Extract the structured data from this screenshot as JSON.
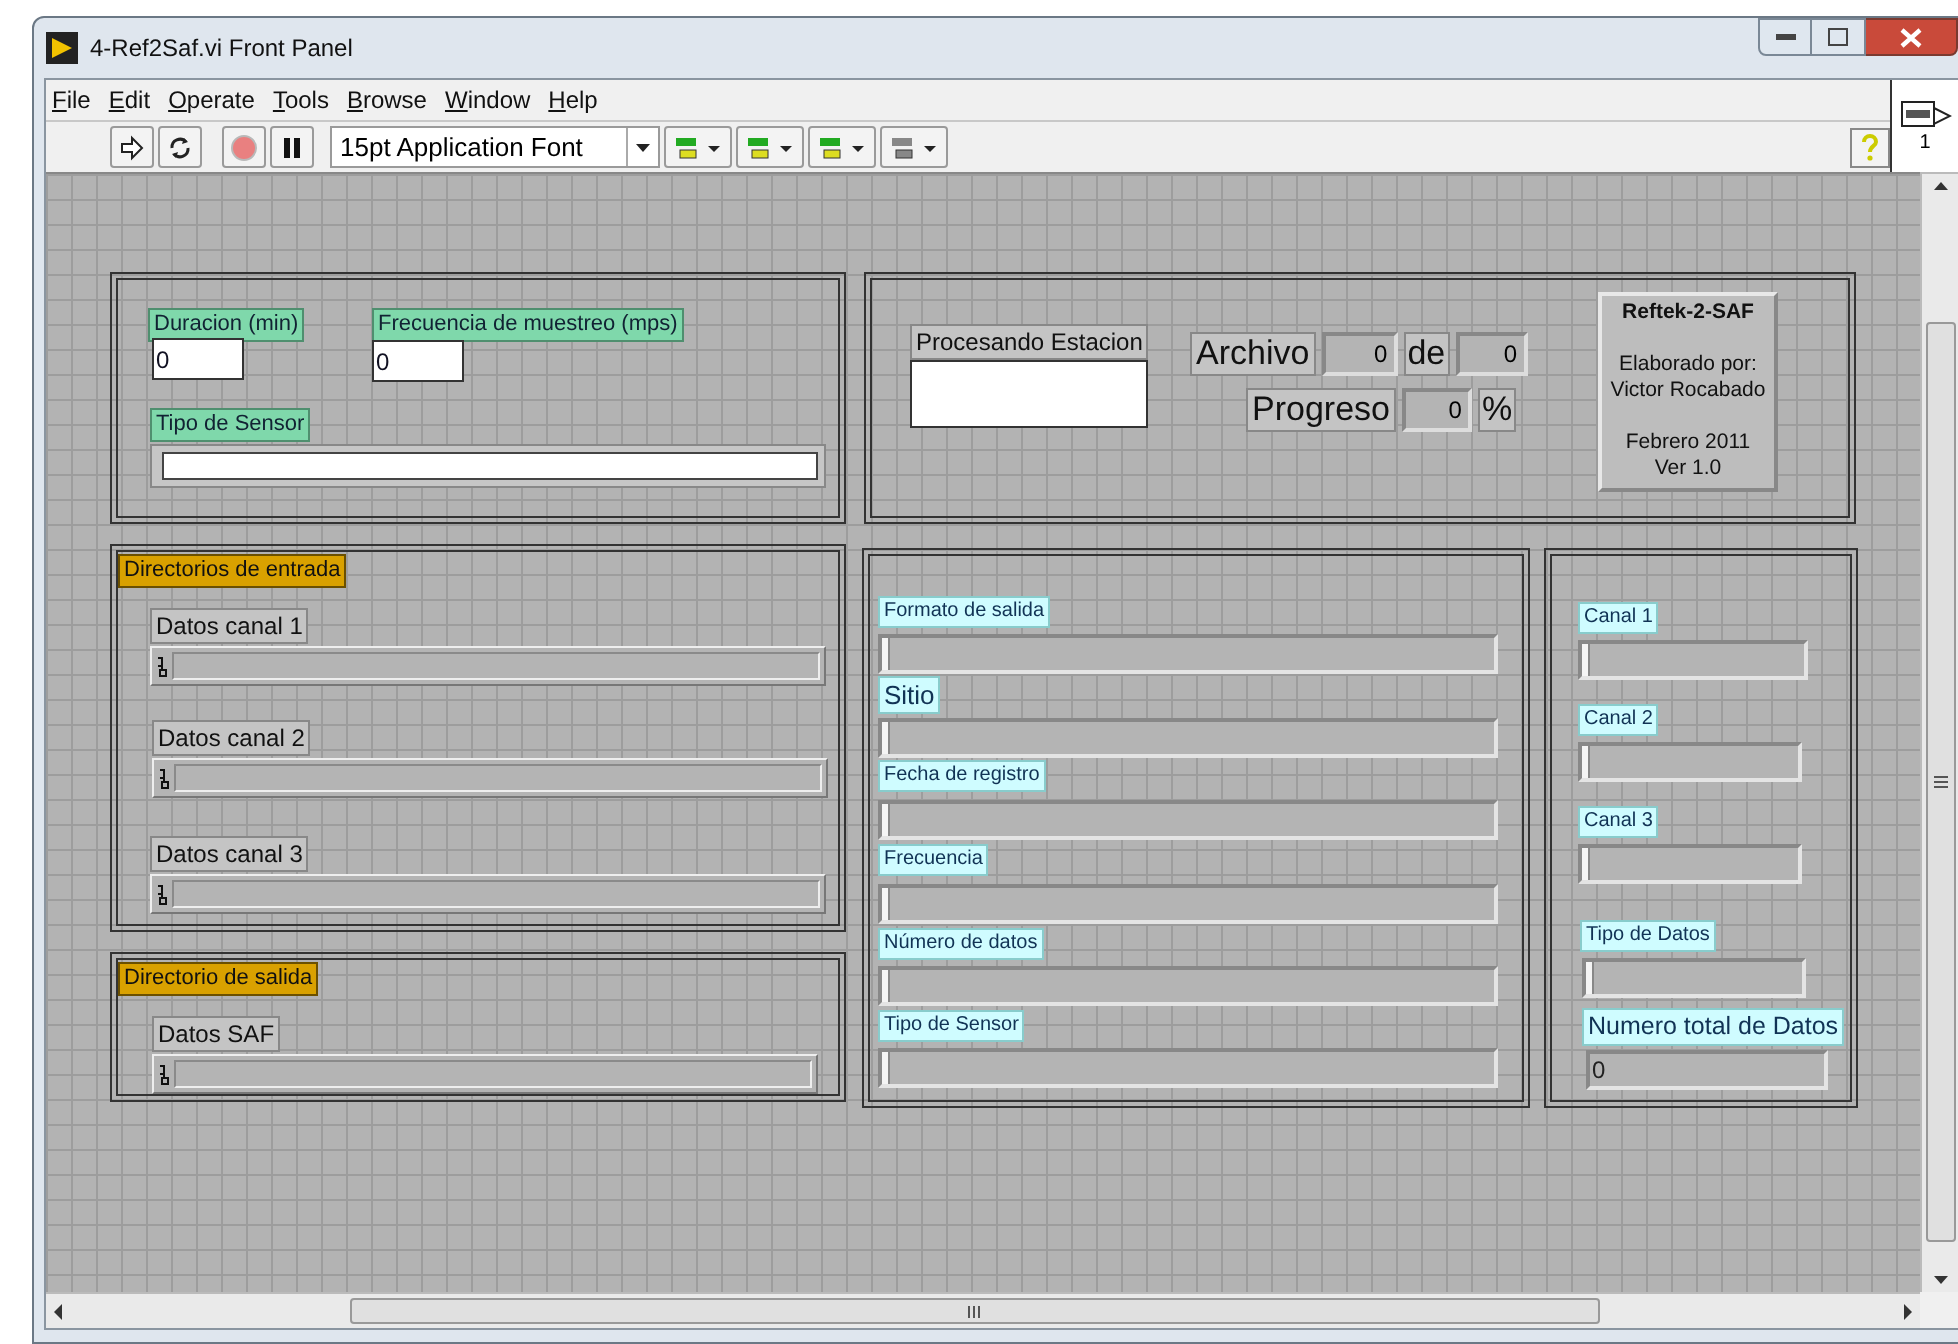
{
  "window": {
    "title": "4-Ref2Saf.vi Front Panel"
  },
  "menu": [
    {
      "label": "File"
    },
    {
      "label": "Edit"
    },
    {
      "label": "Operate"
    },
    {
      "label": "Tools"
    },
    {
      "label": "Browse"
    },
    {
      "label": "Window"
    },
    {
      "label": "Help"
    }
  ],
  "toolbar": {
    "font": "15pt Application Font"
  },
  "connector_pane": {
    "label": "1"
  },
  "settings_panel": {
    "controls": [
      {
        "kind": "numeric",
        "label": "Duracion (min)",
        "value": "0"
      },
      {
        "kind": "numeric",
        "label": "Frecuencia de muestreo (mps)",
        "value": "0"
      },
      {
        "kind": "string",
        "label": "Tipo de Sensor"
      }
    ]
  },
  "status_panel": {
    "station_label": "Procesando Estacion",
    "file_label": "Archivo",
    "file_current": "0",
    "file_of": "de",
    "file_total": "0",
    "progress_label": "Progreso",
    "progress_value": "0",
    "progress_unit": "%",
    "about": [
      "Reftek-2-SAF",
      "Elaborado por:",
      "Victor Rocabado",
      "Febrero 2011",
      "Ver 1.0"
    ]
  },
  "input_dirs": {
    "title": "Directorios de entrada",
    "paths": [
      {
        "label": "Datos canal 1"
      },
      {
        "label": "Datos canal 2"
      },
      {
        "label": "Datos canal 3"
      }
    ]
  },
  "output_dir": {
    "title": "Directorio de salida",
    "paths": [
      {
        "label": "Datos SAF"
      }
    ]
  },
  "output_info": {
    "indicators": [
      {
        "label": "Formato de salida"
      },
      {
        "label": "Sitio"
      },
      {
        "label": "Fecha de registro"
      },
      {
        "label": "Frecuencia"
      },
      {
        "label": "Número de datos"
      },
      {
        "label": "Tipo de Sensor"
      }
    ]
  },
  "channels_info": {
    "indicators": [
      {
        "kind": "string",
        "label": "Canal 1"
      },
      {
        "kind": "string",
        "label": "Canal 2"
      },
      {
        "kind": "string",
        "label": "Canal 3"
      },
      {
        "kind": "string",
        "label": "Tipo de Datos"
      },
      {
        "kind": "numeric",
        "label": "Numero total de Datos",
        "value": "0"
      }
    ]
  }
}
